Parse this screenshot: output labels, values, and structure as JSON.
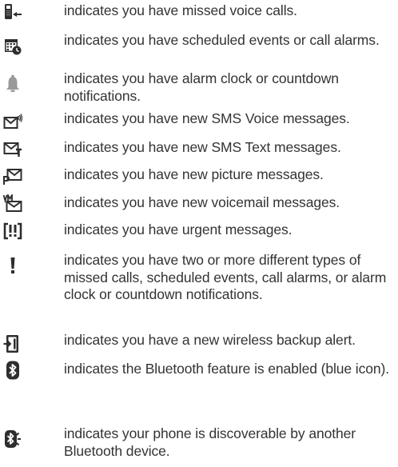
{
  "entries": [
    {
      "icon": "missed-voice-calls-icon",
      "text": "indicates you have missed voice calls."
    },
    {
      "icon": "scheduled-events-calendar-icon",
      "text": "indicates you have scheduled events or call alarms."
    },
    {
      "icon": "alarm-bell-icon",
      "text": "indicates you have alarm clock or countdown notifications."
    },
    {
      "icon": "sms-voice-message-icon",
      "text": "indicates you have new SMS Voice messages."
    },
    {
      "icon": "sms-text-message-icon",
      "text": "indicates you have new SMS Text messages."
    },
    {
      "icon": "picture-message-icon",
      "text": "indicates you have new picture messages."
    },
    {
      "icon": "voicemail-message-icon",
      "text": "indicates you have new voicemail messages."
    },
    {
      "icon": "urgent-message-icon",
      "text": "indicates you have urgent messages."
    },
    {
      "icon": "exclamation-multiple-notifications-icon",
      "text": "indicates you have two or more different types of missed calls, scheduled events, call alarms, or alarm clock or countdown notifications."
    },
    {
      "icon": "wireless-backup-alert-icon",
      "text": "indicates you have a new wireless backup alert."
    },
    {
      "icon": "bluetooth-enabled-icon",
      "text": "indicates the Bluetooth feature is enabled (blue icon)."
    },
    {
      "icon": "bluetooth-discoverable-icon",
      "text": "indicates your phone is discoverable by another Bluetooth device."
    }
  ]
}
